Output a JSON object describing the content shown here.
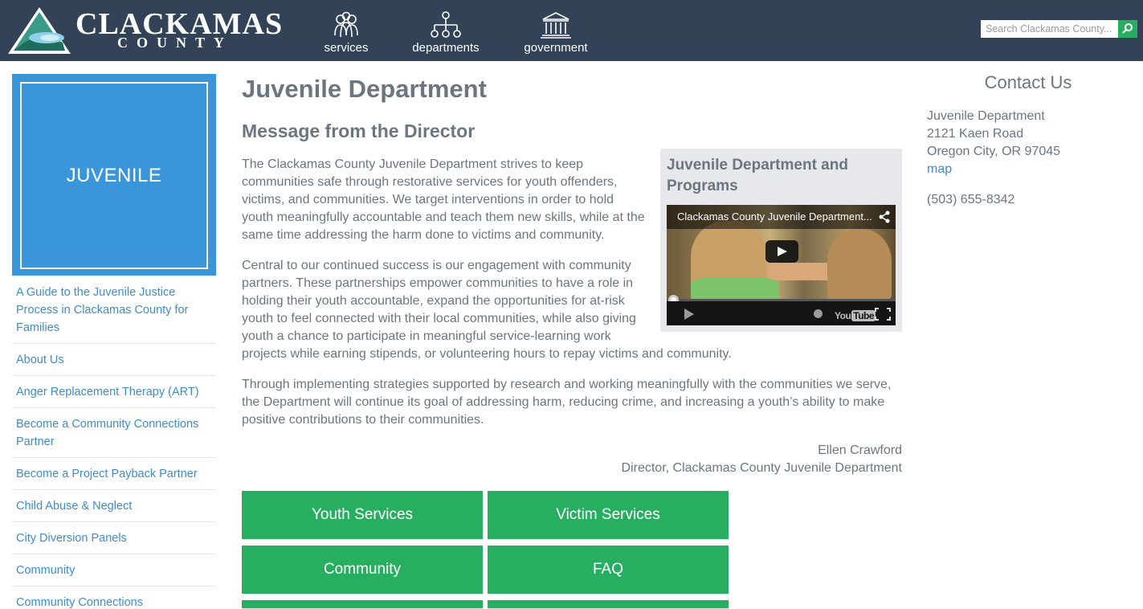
{
  "header": {
    "logo_name": "CLACKAMAS",
    "logo_sub": "COUNTY",
    "nav": [
      {
        "label": "services",
        "icon": "people-icon"
      },
      {
        "label": "departments",
        "icon": "org-chart-icon"
      },
      {
        "label": "government",
        "icon": "capitol-building-icon"
      }
    ],
    "search": {
      "placeholder": "Search Clackamas County..."
    }
  },
  "sidebar": {
    "tile_label": "JUVENILE",
    "links": [
      "A Guide to the Juvenile Justice Process in Clackamas County for Families",
      "About Us",
      "Anger Replacement Therapy (ART)",
      "Become a Community Connections Partner",
      "Become a Project Payback Partner",
      "Child Abuse & Neglect",
      "City Diversion Panels",
      "Community",
      "Community Connections"
    ]
  },
  "main": {
    "title": "Juvenile Department",
    "subtitle": "Message from the Director",
    "paragraphs": [
      "The Clackamas County Juvenile Department strives to keep communities safe through restorative services for youth offenders, victims, and communities.  We target interventions in order to hold youth meaningfully accountable and teach them new skills, while at the same time addressing the harm done to victims and community.",
      "Central to our continued success is our engagement with community partners.  These partnerships empower communities to have a role in holding their youth accountable, expand the opportunities for at-risk youth to feel connected with their local communities, while also giving youth a chance to participate in meaningful service-learning work projects while earning stipends, or volunteering hours to repay victims and community.",
      "Through implementing strategies supported by research and working meaningfully with the communities we serve, the Department will continue its goal of addressing harm, reducing crime, and increasing a youth’s ability to make positive contributions to their communities."
    ],
    "signature_name": "Ellen Crawford",
    "signature_title": "Director, Clackamas County Juvenile Department",
    "video": {
      "box_title": "Juvenile Department and Programs",
      "video_title": "Clackamas County Juvenile Department...",
      "brand": "You",
      "brand_tube": "Tube"
    },
    "buttons": [
      "Youth Services",
      "Victim Services",
      "Community",
      "FAQ"
    ]
  },
  "contact": {
    "title": "Contact Us",
    "name": "Juvenile Department",
    "street": "2121 Kaen Road",
    "city": "Oregon City, OR 97045",
    "map_link": "map",
    "phone": "(503) 655-8342"
  },
  "colors": {
    "header_bg": "#324358",
    "accent_green": "#27ae60",
    "tile_blue": "#3b96d9",
    "link_blue": "#3f8cc8",
    "text_gray": "#6b7680"
  }
}
